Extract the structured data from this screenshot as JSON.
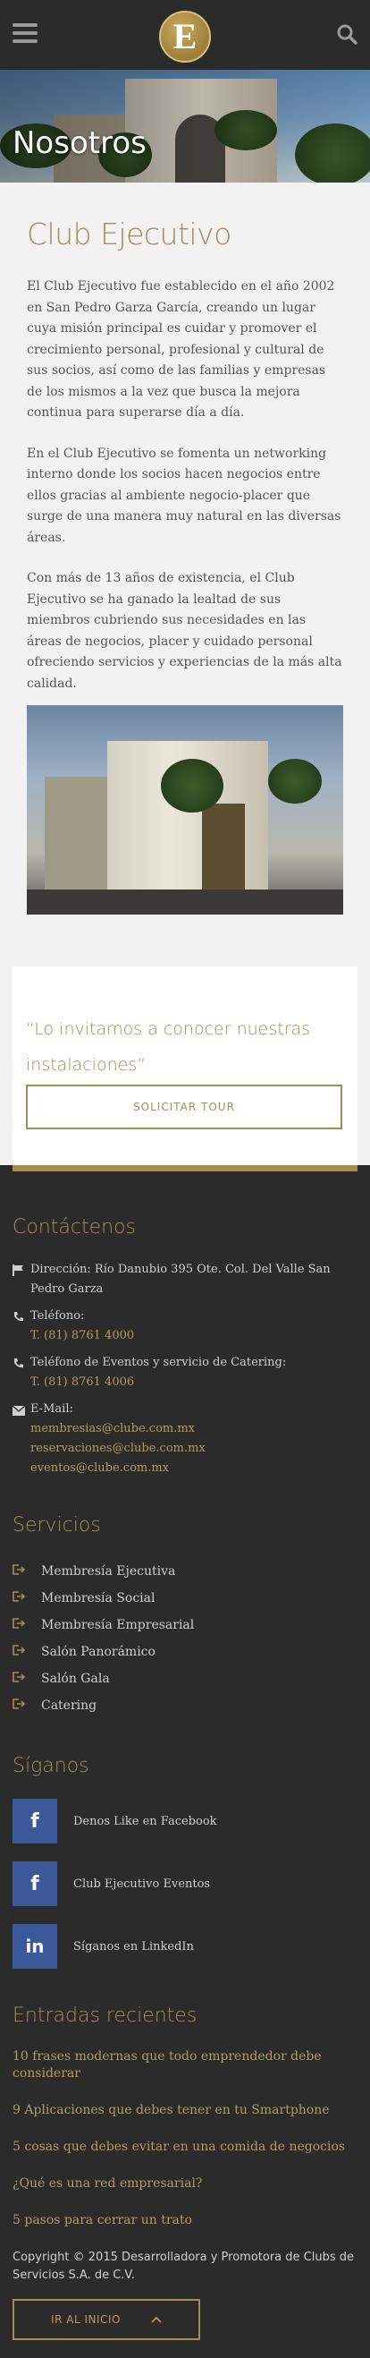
{
  "header": {
    "logo_letter": "E"
  },
  "hero": {
    "title": "Nosotros"
  },
  "about": {
    "heading": "Club Ejecutivo",
    "paragraphs": [
      "El Club Ejecutivo fue establecido en el año 2002 en San Pedro Garza García, creando un lugar cuya misión principal es cuidar y promover el crecimiento personal, profesional y cultural de sus socios, así como de las familias y empresas de los mismos a la vez que busca la mejora continua para superarse día a día.",
      "En el Club Ejecutivo se fomenta un networking interno donde los socios hacen negocios entre ellos gracias al ambiente negocio-placer que surge de una manera muy natural en las diversas áreas.",
      "Con más de 13 años de existencia, el Club Ejecutivo se ha ganado la lealtad de sus miembros cubriendo sus necesidades en las áreas de negocios, placer y cuidado personal ofreciendo servicios y experiencias de la más alta calidad."
    ]
  },
  "invite": {
    "quote": "“Lo invitamos a conocer nuestras instalaciones”",
    "button": "SOLICITAR TOUR"
  },
  "contact": {
    "heading": "Contáctenos",
    "address": "Dirección: Río Danubio 395 Ote. Col. Del Valle San Pedro Garza",
    "phone_label": "Teléfono:",
    "phone": "T. (81) 8761 4000",
    "events_label": "Teléfono de Eventos y servicio de Catering:",
    "events_phone": "T. (81) 8761 4006",
    "email_label": "E-Mail:",
    "emails": [
      "membresias@clube.com.mx",
      "reservaciones@clube.com.mx",
      "eventos@clube.com.mx"
    ]
  },
  "services": {
    "heading": "Servicios",
    "items": [
      "Membresía Ejecutiva",
      "Membresía Social",
      "Membresía Empresarial",
      "Salón Panorámico",
      "Salón Gala",
      "Catering"
    ]
  },
  "follow": {
    "heading": "Síganos",
    "items": [
      {
        "icon": "f",
        "label": "Denos Like en Facebook"
      },
      {
        "icon": "f",
        "label": "Club Ejecutivo Eventos"
      },
      {
        "icon": "in",
        "label": "Síganos en LinkedIn"
      }
    ]
  },
  "recent": {
    "heading": "Entradas recientes",
    "items": [
      "10 frases modernas que todo emprendedor debe considerar",
      "9 Aplicaciones que debes tener en tu Smartphone",
      "5 cosas que debes evitar en una comida de negocios",
      "¿Qué es una red empresarial?",
      "5 pasos para cerrar un trato"
    ]
  },
  "footer": {
    "copyright": "Copyright © 2015 Desarrolladora y Promotora de Clubs de Servicios S.A. de C.V.",
    "top_button": "IR AL INICIO"
  },
  "colors": {
    "gold": "#a78c54",
    "dark": "#2b2b2b",
    "light": "#f2f2f2"
  }
}
